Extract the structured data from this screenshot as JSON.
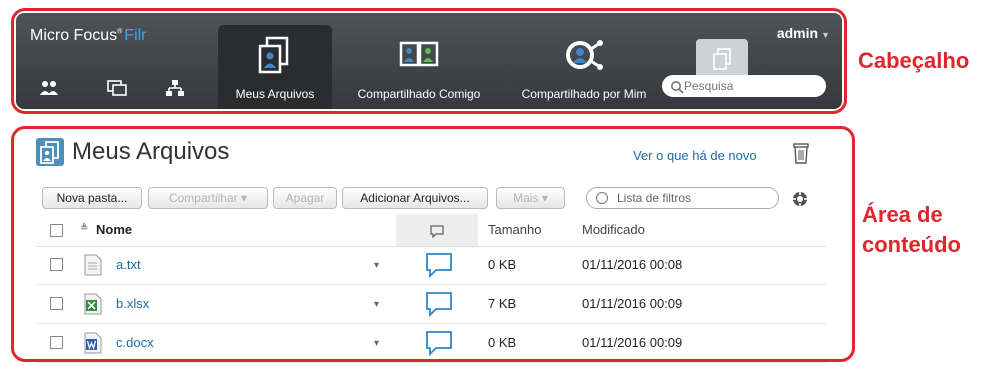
{
  "header": {
    "brand": "Micro Focus",
    "brand_product": "Filr",
    "user": "admin",
    "tiles": [
      {
        "label": "Meus Arquivos",
        "icon": "my-files-icon",
        "active": true
      },
      {
        "label": "Compartilhado Comigo",
        "icon": "shared-with-me-icon",
        "active": false
      },
      {
        "label": "Compartilhado por Mim",
        "icon": "shared-by-me-icon",
        "active": false
      }
    ],
    "search_placeholder": "Pesquisa"
  },
  "annotations": {
    "header": "Cabeçalho",
    "content_line1": "Área de",
    "content_line2": "conteúdo"
  },
  "content": {
    "title": "Meus Arquivos",
    "whats_new": "Ver o que há de novo",
    "toolbar": {
      "new_folder": "Nova pasta...",
      "share": "Compartilhar",
      "delete": "Apagar",
      "add_files": "Adicionar Arquivos...",
      "more": "Mais"
    },
    "filter_placeholder": "Lista de filtros",
    "columns": {
      "name": "Nome",
      "size": "Tamanho",
      "modified": "Modificado"
    },
    "files": [
      {
        "name": "a.txt",
        "size": "0 KB",
        "modified": "01/11/2016 00:08",
        "icon": "text-file-icon"
      },
      {
        "name": "b.xlsx",
        "size": "7 KB",
        "modified": "01/11/2016 00:09",
        "icon": "excel-file-icon"
      },
      {
        "name": "c.docx",
        "size": "0 KB",
        "modified": "01/11/2016 00:09",
        "icon": "word-file-icon"
      }
    ],
    "colors": {
      "accent": "#1f6aa9",
      "annotation": "#e0262c",
      "header_bg": "#3f4347"
    }
  }
}
